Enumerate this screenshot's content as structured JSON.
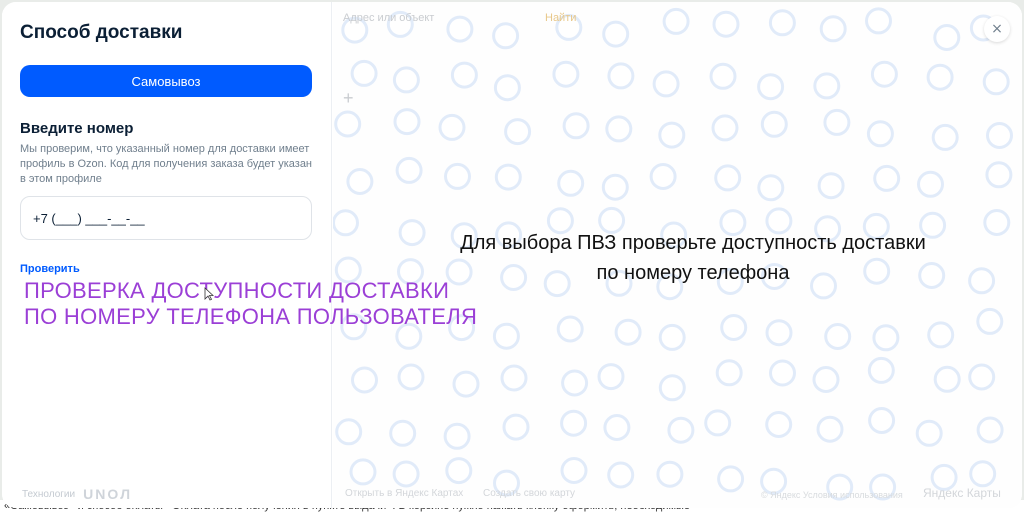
{
  "panel": {
    "title": "Способ доставки",
    "pickup_label": "Самовывоз",
    "phone_heading": "Введите номер",
    "phone_description": "Мы проверим, что указанный номер для доставки имеет профиль в Ozon. Код для получения заказа будет указан в этом профиле",
    "phone_value": "+7 (___) ___-__-__",
    "check_label": "Проверить",
    "tech_label": "Технологии",
    "tech_logo": "UNOЛ"
  },
  "map": {
    "message_line1": "Для выбора ПВЗ проверьте доступность доставки",
    "message_line2": "по номеру телефона",
    "search_text": "Адрес или объект",
    "find_label": "Найти",
    "zoom_plus": "+",
    "footer_left": "Открыть в Яндекс Картах",
    "footer_mid": "Создать свою карту",
    "footer_right": "© Яндекс Условия использования",
    "logo_text": "Яндекс Карты"
  },
  "annotation": {
    "line1": "ПРОВЕРКА ДОСТУПНОСТИ ДОСТАВКИ",
    "line2": "ПО НОМЕРУ ТЕЛЕФОНА ПОЛЬЗОВАТЕЛЯ"
  },
  "background_strip_text": "«Самовывоз» и способ оплаты «Оплата после получения в пункте выдачи». В корзине нужно нажать кнопку оформить, необходимые",
  "close_icon": "×",
  "colors": {
    "accent": "#005bff",
    "annotation": "#9b3fd6",
    "map_marker": "#2f6fd6"
  }
}
